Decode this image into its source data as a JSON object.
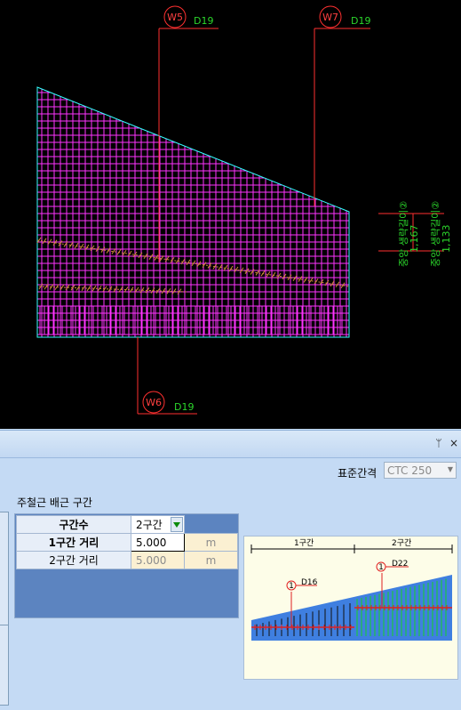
{
  "drawing": {
    "tags": [
      {
        "id": "W5",
        "size": "D19"
      },
      {
        "id": "W7",
        "size": "D19"
      },
      {
        "id": "W6",
        "size": "D19"
      }
    ],
    "side_labels": [
      {
        "text": "중앙 생략길이②",
        "value": "1,167"
      },
      {
        "text": "중앙 생략길이②",
        "value": "1,133"
      }
    ],
    "colors": {
      "background": "#000000",
      "mesh": "#ff33ff",
      "outline": "#33ffff",
      "leader": "#ff3030",
      "label": "#2bd62b"
    }
  },
  "panel": {
    "pin_icon": "ᛘ",
    "close_icon": "×",
    "standard_spacing": {
      "label": "표준간격",
      "value": "CTC 250"
    },
    "section_title": "주철근 배근 구간",
    "grid": {
      "header_label": "구간수",
      "header_value": "2구간",
      "rows": [
        {
          "label": "1구간 거리",
          "value": "5.000",
          "unit": "m"
        },
        {
          "label": "2구간 거리",
          "value": "5.000",
          "unit": "m"
        }
      ]
    },
    "diagram": {
      "zone1": "1구간",
      "zone2": "2구간",
      "bar1_num": "1",
      "bar1_size": "D16",
      "bar2_num": "1",
      "bar2_size": "D22"
    }
  }
}
